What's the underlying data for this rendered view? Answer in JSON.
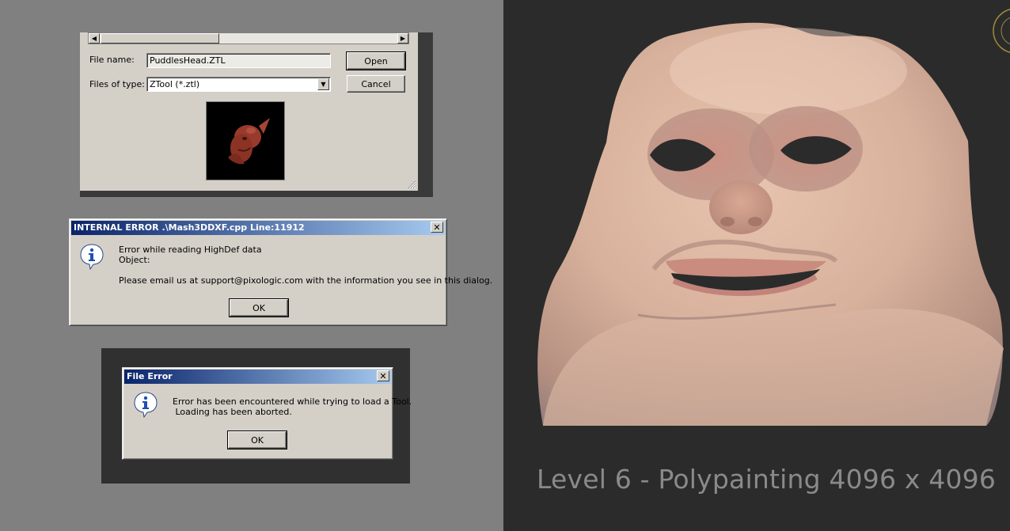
{
  "open_dialog": {
    "file_name_label": "File name:",
    "file_name_value": "PuddlesHead.ZTL",
    "files_of_type_label": "Files of type:",
    "files_of_type_value": "ZTool (*.ztl)",
    "open_label": "Open",
    "cancel_label": "Cancel"
  },
  "internal_error_dialog": {
    "title": "INTERNAL ERROR .\\Mash3DDXF.cpp  Line:11912",
    "line1": "Error while reading HighDef data",
    "line2": "Object:",
    "line3": "Please email us at support@pixologic.com with the information you see in this dialog.",
    "ok_label": "OK"
  },
  "file_error_dialog": {
    "title": "File Error",
    "line1": "Error has been encountered while trying to load a Tool.",
    "line2": " Loading has been aborted.",
    "ok_label": "OK"
  },
  "viewport": {
    "caption": "Level 6 - Polypainting 4096 x 4096"
  },
  "icons": [
    "scroll-left-arrow-icon",
    "scroll-right-arrow-icon",
    "dropdown-arrow-icon",
    "info-icon",
    "close-icon",
    "resize-grip-icon",
    "logo-ring-icon"
  ],
  "colors": {
    "titlebar_start": "#0a246a",
    "titlebar_end": "#a6caf0",
    "dialog_face": "#d4d0c8",
    "viewport_bg": "#2b2b2b",
    "caption_text": "#8a8a8a"
  }
}
